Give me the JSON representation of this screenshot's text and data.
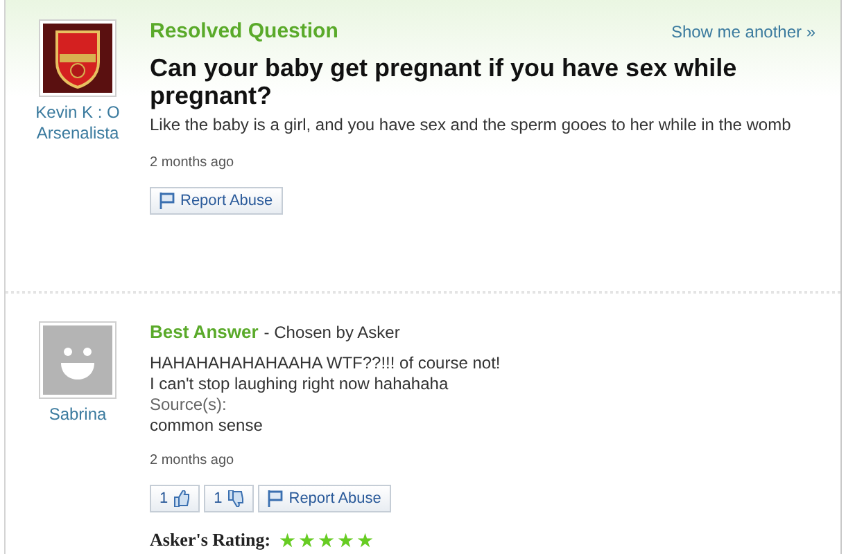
{
  "question": {
    "status": "Resolved Question",
    "show_another": "Show me another »",
    "asker": {
      "name": "Kevin K : O Arsenalista"
    },
    "title": "Can your baby get pregnant if you have sex while pregnant?",
    "details": "Like the baby is a girl, and you have sex and the sperm gooes to her while in the womb",
    "time": "2 months ago",
    "report": "Report Abuse"
  },
  "best_answer": {
    "heading": "Best Answer",
    "chosen": "- Chosen by Asker",
    "answerer": {
      "name": "Sabrina"
    },
    "lines": [
      "HAHAHAHAHAHAAHA WTF??!!! of course not!",
      "I can't stop laughing right now hahahaha"
    ],
    "sources_label": "Source(s):",
    "sources": "common sense",
    "time": "2 months ago",
    "thumbs_up": "1",
    "thumbs_down": "1",
    "report": "Report Abuse",
    "rating_label": "Asker's Rating:",
    "stars": 5
  }
}
